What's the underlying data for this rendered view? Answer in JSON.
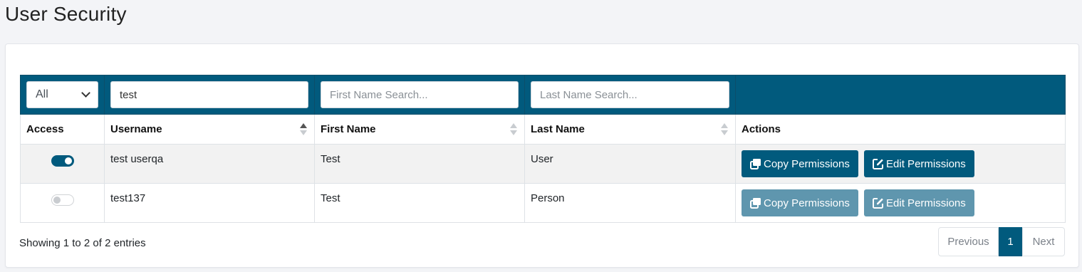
{
  "page": {
    "title": "User Security"
  },
  "filters": {
    "access_select": "All",
    "username_value": "test",
    "first_name_placeholder": "First Name Search...",
    "last_name_placeholder": "Last Name Search..."
  },
  "columns": [
    "Access",
    "Username",
    "First Name",
    "Last Name",
    "Actions"
  ],
  "rows": [
    {
      "access": true,
      "username": "test userqa",
      "first_name": "Test",
      "last_name": "User",
      "copy_label": "Copy Permissions",
      "edit_label": "Edit Permissions"
    },
    {
      "access": false,
      "username": "test137",
      "first_name": "Test",
      "last_name": "Person",
      "copy_label": "Copy Permissions",
      "edit_label": "Edit Permissions"
    }
  ],
  "footer": {
    "info": "Showing 1 to 2 of 2 entries",
    "prev": "Previous",
    "page": "1",
    "next": "Next"
  },
  "colors": {
    "primary": "#015a7d",
    "disabled": "#5f96ae"
  }
}
